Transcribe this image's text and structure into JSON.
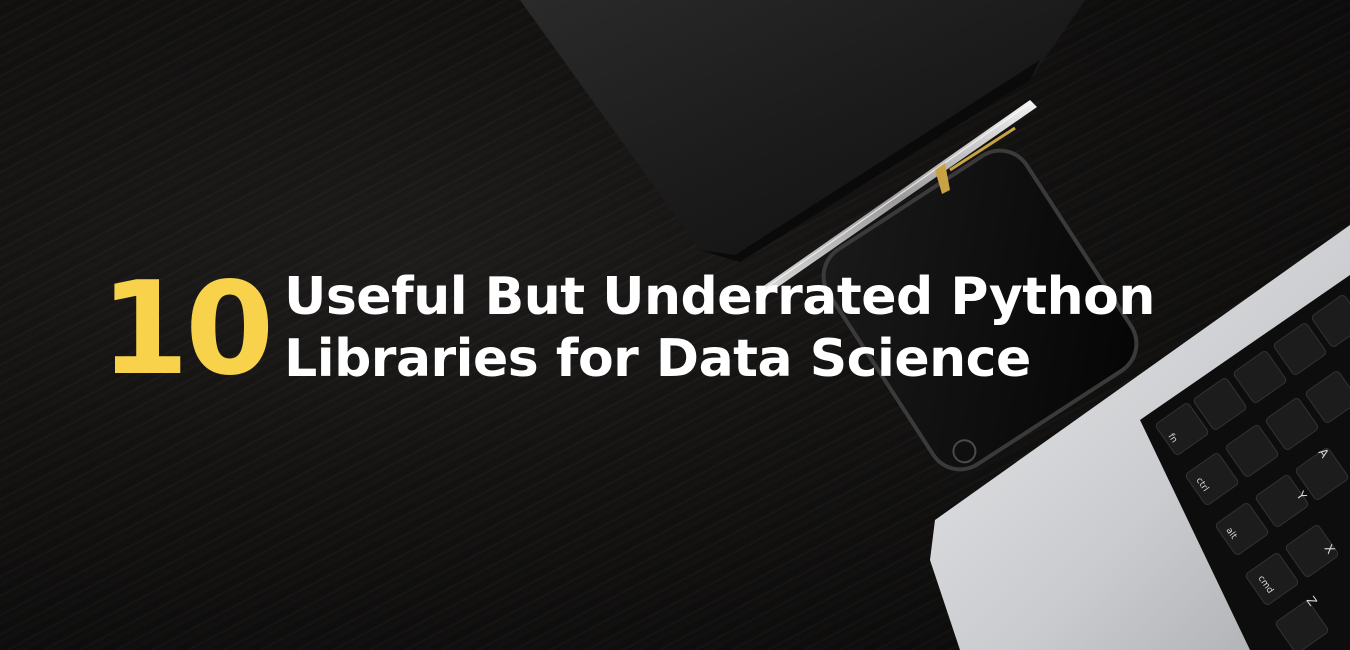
{
  "headline": {
    "number": "10",
    "line1": "Useful But Underrated Python",
    "line2": "Libraries for Data Science"
  },
  "colors": {
    "background": "#111010",
    "number": "#f7d24a",
    "title": "#ffffff"
  },
  "keyboard_legends": [
    "fn",
    "ctrl",
    "alt",
    "cmd",
    "A",
    "Z",
    "X",
    "Y"
  ]
}
